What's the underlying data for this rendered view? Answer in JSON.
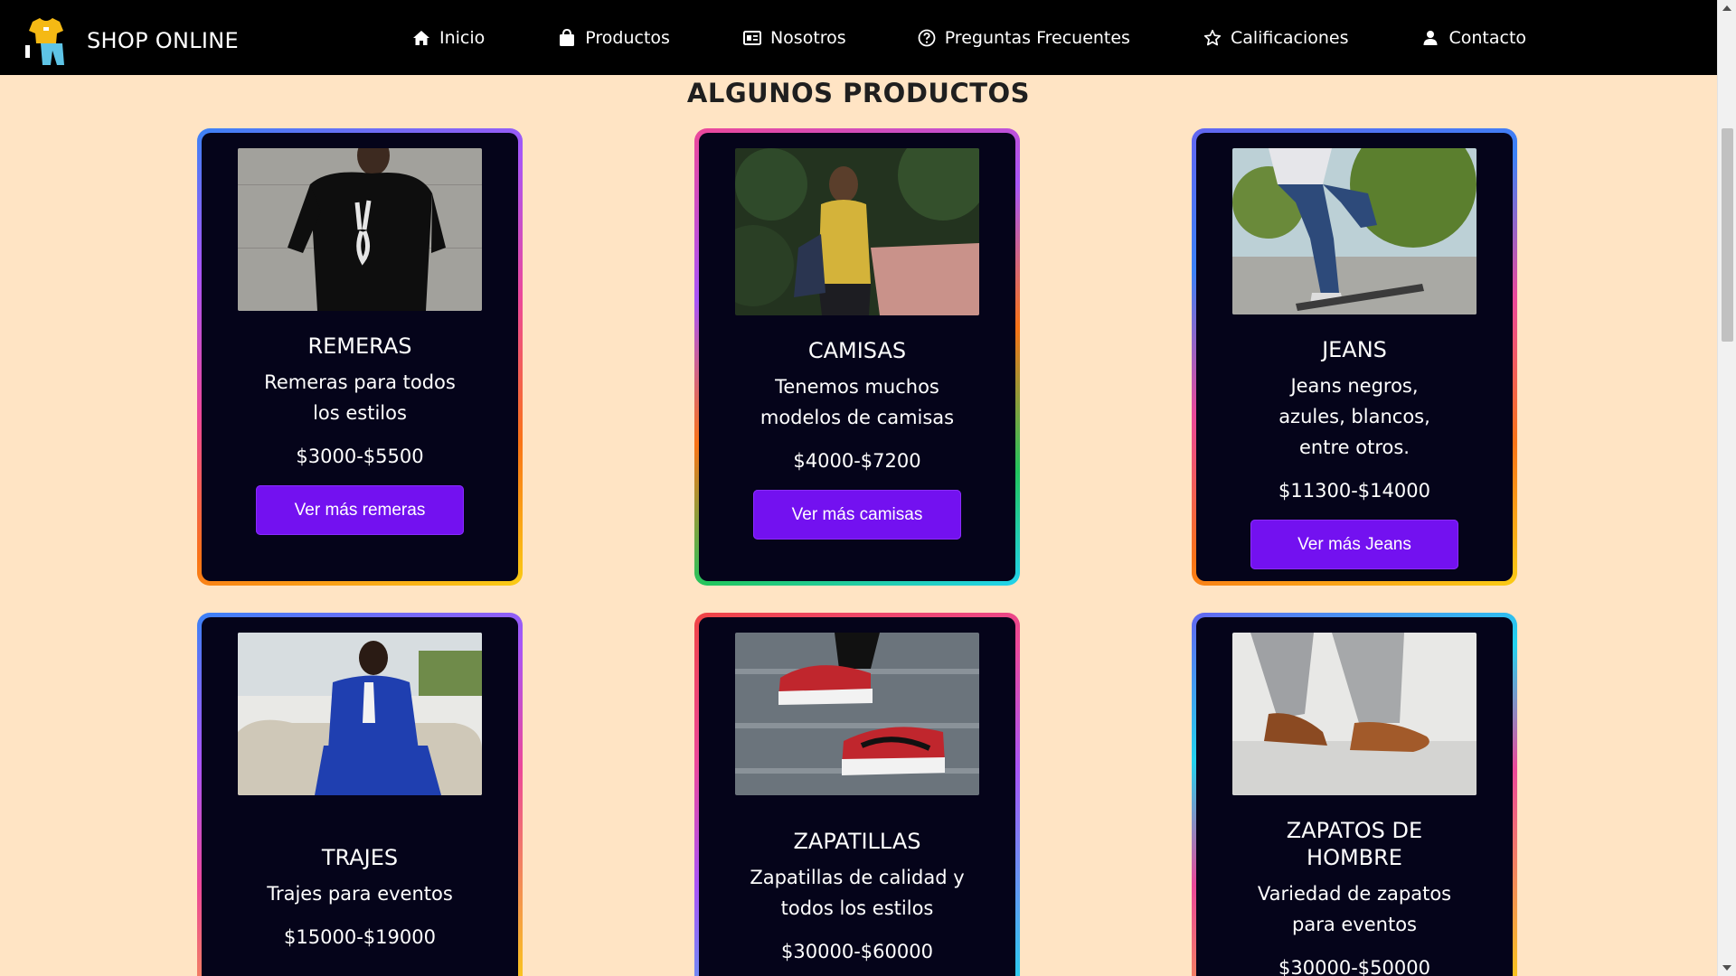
{
  "brand": {
    "name": "SHOP ONLINE"
  },
  "nav": [
    {
      "label": "Inicio",
      "icon": "home-icon"
    },
    {
      "label": "Productos",
      "icon": "shopping-bag-icon"
    },
    {
      "label": "Nosotros",
      "icon": "id-card-icon"
    },
    {
      "label": "Preguntas Frecuentes",
      "icon": "question-circle-icon"
    },
    {
      "label": "Calificaciones",
      "icon": "star-icon"
    },
    {
      "label": "Contacto",
      "icon": "user-icon"
    }
  ],
  "section": {
    "title": "ALGUNOS PRODUCTOS"
  },
  "products": [
    {
      "title": "REMERAS",
      "desc": "Remeras para todos los estilos",
      "price": "$3000-$5500",
      "button": "Ver más remeras",
      "image": "man in black t-shirt"
    },
    {
      "title": "CAMISAS",
      "desc": "Tenemos muchos modelos de camisas",
      "price": "$4000-$7200",
      "button": "Ver más camisas",
      "image": "man in yellow shirt"
    },
    {
      "title": "JEANS",
      "desc": "Jeans negros, azules, blancos, entre otros.",
      "price": "$11300-$14000",
      "button": "Ver más Jeans",
      "image": "jeans and skateboard"
    },
    {
      "title": "TRAJES",
      "desc": "Trajes para eventos",
      "price": "$15000-$19000",
      "button": "",
      "image": "man in blue suit"
    },
    {
      "title": "ZAPATILLAS",
      "desc": "Zapatillas de calidad y todos los estilos",
      "price": "$30000-$60000",
      "button": "",
      "image": "red and white sneakers"
    },
    {
      "title": "ZAPATOS DE HOMBRE",
      "desc": "Variedad de zapatos para eventos",
      "price": "$30000-$50000",
      "button": "",
      "image": "brown leather shoes"
    }
  ],
  "colors": {
    "background": "#ffe4c4",
    "navbar": "#000000",
    "card": "#05041a",
    "button": "#7311f0"
  }
}
